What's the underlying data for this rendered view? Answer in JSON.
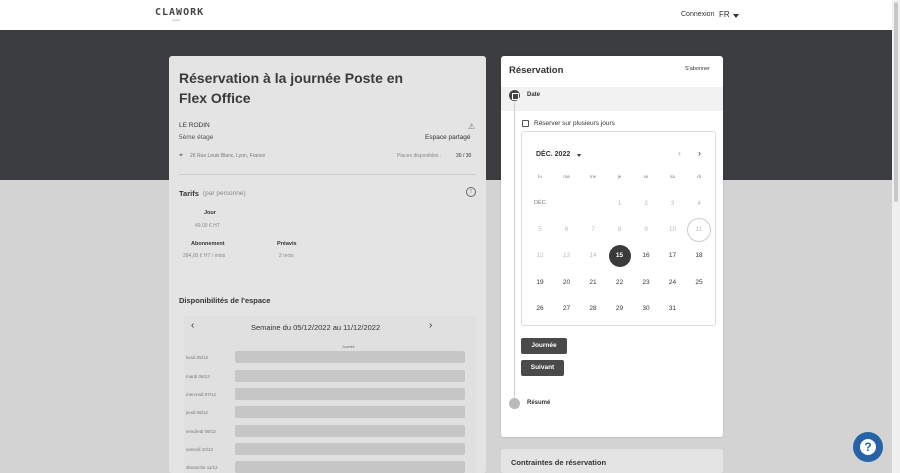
{
  "header": {
    "logo": "CLAWORK",
    "logo_sub": "space",
    "login": "Connexion",
    "lang": "FR"
  },
  "space": {
    "title": "Réservation à la journée Poste en Flex Office",
    "name": "LE RODIN",
    "floor": "5ème étage",
    "type": "Espace partagé",
    "address": "26 Rue Louis Blanc, Lyon, France",
    "places_label": "Places disponibles :",
    "places_value": "30 / 30"
  },
  "tarifs": {
    "title": "Tarifs",
    "note": "(par personne)",
    "day_label": "Jour",
    "day_price": "49,00 € HT",
    "abo_label": "Abonnement",
    "abo_price": "394,00 € HT / mois",
    "preavis_label": "Préavis",
    "preavis_value": "2 mois"
  },
  "availability": {
    "title": "Disponibilités de l'espace",
    "week_label": "Semaine du 05/12/2022 au 11/12/2022",
    "column": "Journée",
    "days": [
      "lundi 05/12",
      "mardi 06/12",
      "mercredi 07/12",
      "jeudi 08/12",
      "vendredi 09/12",
      "samedi 10/12",
      "dimanche 11/12"
    ]
  },
  "reservation": {
    "title": "Réservation",
    "subscribe": "S'abonner",
    "date_step": "Date",
    "multi_days": "Réserver sur plusieurs jours",
    "journee_button": "Journée",
    "next_button": "Suivant",
    "summary_step": "Résumé"
  },
  "calendar": {
    "month": "DÉC. 2022",
    "month_short": "DÉC.",
    "weekdays": [
      "lu",
      "ma",
      "me",
      "je",
      "ve",
      "sa",
      "di"
    ],
    "selected_day": "15",
    "weeks": [
      [
        "",
        "",
        "",
        "1",
        "2",
        "3",
        "4"
      ],
      [
        "5",
        "6",
        "7",
        "8",
        "9",
        "10",
        "11"
      ],
      [
        "12",
        "13",
        "14",
        "15",
        "16",
        "17",
        "18"
      ],
      [
        "19",
        "20",
        "21",
        "22",
        "23",
        "24",
        "25"
      ],
      [
        "26",
        "27",
        "28",
        "29",
        "30",
        "31",
        ""
      ]
    ]
  },
  "constraints": {
    "title": "Contraintes de réservation"
  },
  "help": {
    "icon": "question-icon"
  }
}
